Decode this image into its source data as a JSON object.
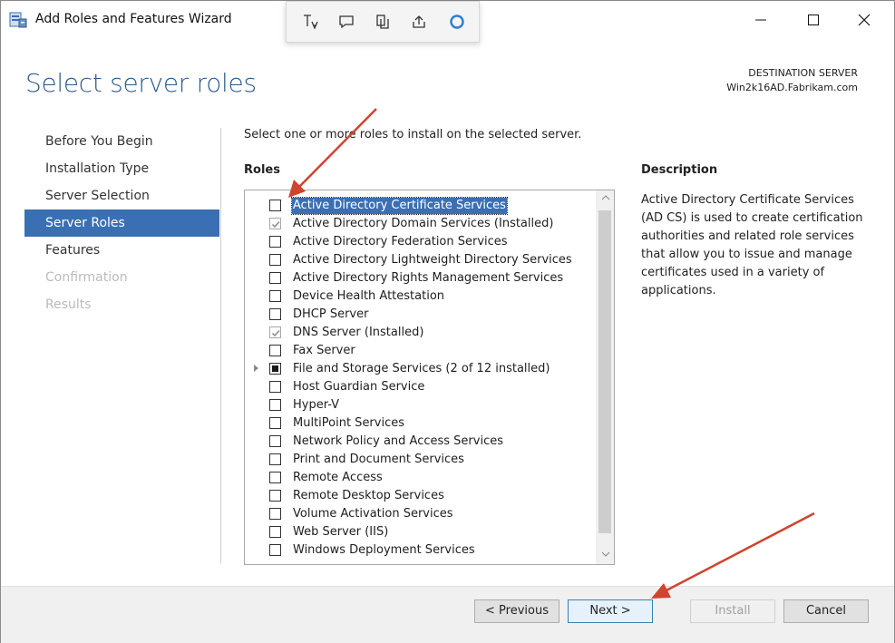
{
  "window": {
    "title": "Add Roles and Features Wizard",
    "minimize_label": "—",
    "maximize_label": "☐",
    "close_label": "✕"
  },
  "header": {
    "page_title": "Select server roles",
    "destination_label": "DESTINATION SERVER",
    "destination_server": "Win2k16AD.Fabrikam.com"
  },
  "nav": {
    "items": [
      {
        "label": "Before You Begin",
        "state": "normal"
      },
      {
        "label": "Installation Type",
        "state": "normal"
      },
      {
        "label": "Server Selection",
        "state": "normal"
      },
      {
        "label": "Server Roles",
        "state": "active"
      },
      {
        "label": "Features",
        "state": "normal"
      },
      {
        "label": "Confirmation",
        "state": "disabled"
      },
      {
        "label": "Results",
        "state": "disabled"
      }
    ]
  },
  "content": {
    "instruction": "Select one or more roles to install on the selected server.",
    "roles_heading": "Roles",
    "description_heading": "Description",
    "description_text": "Active Directory Certificate Services (AD CS) is used to create certification authorities and related role services that allow you to issue and manage certificates used in a variety of applications.",
    "roles": [
      {
        "label": "Active Directory Certificate Services",
        "state": "unchecked",
        "selected": true
      },
      {
        "label": "Active Directory Domain Services (Installed)",
        "state": "checked-installed"
      },
      {
        "label": "Active Directory Federation Services",
        "state": "unchecked"
      },
      {
        "label": "Active Directory Lightweight Directory Services",
        "state": "unchecked"
      },
      {
        "label": "Active Directory Rights Management Services",
        "state": "unchecked"
      },
      {
        "label": "Device Health Attestation",
        "state": "unchecked"
      },
      {
        "label": "DHCP Server",
        "state": "unchecked"
      },
      {
        "label": "DNS Server (Installed)",
        "state": "checked-installed"
      },
      {
        "label": "Fax Server",
        "state": "unchecked"
      },
      {
        "label": "File and Storage Services (2 of 12 installed)",
        "state": "partial",
        "expandable": true
      },
      {
        "label": "Host Guardian Service",
        "state": "unchecked"
      },
      {
        "label": "Hyper-V",
        "state": "unchecked"
      },
      {
        "label": "MultiPoint Services",
        "state": "unchecked"
      },
      {
        "label": "Network Policy and Access Services",
        "state": "unchecked"
      },
      {
        "label": "Print and Document Services",
        "state": "unchecked"
      },
      {
        "label": "Remote Access",
        "state": "unchecked"
      },
      {
        "label": "Remote Desktop Services",
        "state": "unchecked"
      },
      {
        "label": "Volume Activation Services",
        "state": "unchecked"
      },
      {
        "label": "Web Server (IIS)",
        "state": "unchecked"
      },
      {
        "label": "Windows Deployment Services",
        "state": "unchecked"
      }
    ]
  },
  "footer": {
    "previous_label": "< Previous",
    "next_label": "Next >",
    "install_label": "Install",
    "cancel_label": "Cancel"
  },
  "snip_toolbar": {
    "icons": [
      "text-select-icon",
      "comment-icon",
      "copy-icon",
      "share-icon",
      "cortana-circle-icon"
    ]
  },
  "colors": {
    "accent": "#3a6fb3",
    "title": "#2e5b8c",
    "annotation_arrow": "#d0432e"
  }
}
